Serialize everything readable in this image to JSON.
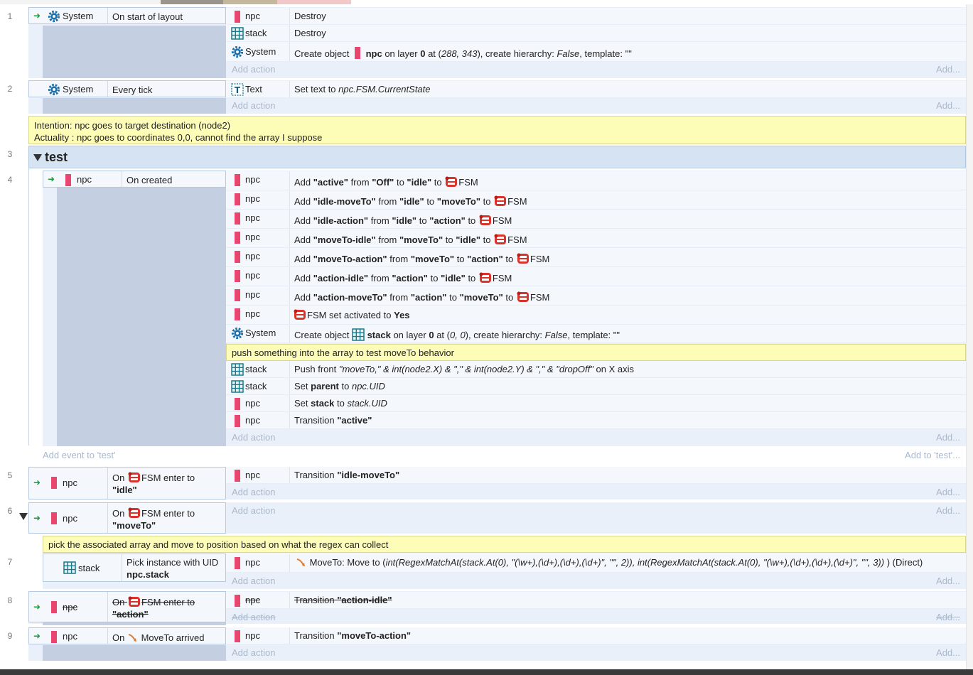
{
  "line_numbers": [
    "1",
    "2",
    "3",
    "4",
    "5",
    "6",
    "7",
    "8",
    "9"
  ],
  "add_action": "Add action",
  "add_action_more": "Add...",
  "events": {
    "e1": {
      "object": "System",
      "condition": "On start of layout",
      "actions": [
        {
          "object": "npc",
          "text": "Destroy"
        },
        {
          "object": "stack",
          "text": "Destroy"
        },
        {
          "object": "System",
          "pre": "Create object",
          "obj": "npc",
          "mid1": "on layer",
          "layer": "0",
          "mid2": "at (",
          "coords": "288, 343",
          "mid3": "), create hierarchy:",
          "hier": "False",
          "mid4": ", template: \"\""
        }
      ]
    },
    "e2": {
      "object": "System",
      "condition": "Every tick",
      "actions": [
        {
          "object": "Text",
          "pre": "Set text to",
          "expr": "npc.FSM.CurrentState"
        }
      ]
    },
    "comment1": {
      "line1": "Intention: npc goes to target destination (node2)",
      "line2": "Actuality : npc goes to coordinates 0,0, cannot find the array I suppose"
    },
    "group": {
      "name": "test",
      "add_event": "Add event to 'test'",
      "add_event_more": "Add to 'test'..."
    },
    "e4": {
      "object": "npc",
      "condition": "On created",
      "fsm_adds": [
        {
          "name": "\"active\"",
          "from": "\"Off\"",
          "to": "\"idle\""
        },
        {
          "name": "\"idle-moveTo\"",
          "from": "\"idle\"",
          "to": "\"moveTo\""
        },
        {
          "name": "\"idle-action\"",
          "from": "\"idle\"",
          "to": "\"action\""
        },
        {
          "name": "\"moveTo-idle\"",
          "from": "\"moveTo\"",
          "to": "\"idle\""
        },
        {
          "name": "\"moveTo-action\"",
          "from": "\"moveTo\"",
          "to": "\"action\""
        },
        {
          "name": "\"action-idle\"",
          "from": "\"action\"",
          "to": "\"idle\""
        },
        {
          "name": "\"action-moveTo\"",
          "from": "\"action\"",
          "to": "\"moveTo\""
        }
      ],
      "words": {
        "add": "Add",
        "from": "from",
        "to": "to",
        "fsm": "FSM"
      },
      "fsm_set": {
        "object": "npc",
        "text": "FSM set activated to",
        "value": "Yes"
      },
      "create": {
        "object": "System",
        "pre": "Create object",
        "obj": "stack",
        "mid1": "on layer",
        "layer": "0",
        "mid2": "at (",
        "coords": "0, 0",
        "mid3": "), create hierarchy:",
        "hier": "False",
        "mid4": ", template: \"\""
      },
      "comment": "push something into the array to test moveTo behavior",
      "push": {
        "object": "stack",
        "pre": "Push front",
        "expr": "\"moveTo,\" & int(node2.X) & \",\" & int(node2.Y) & \",\" & \"dropOff\"",
        "post": "on X axis"
      },
      "set_parent": {
        "object": "stack",
        "pre": "Set",
        "var": "parent",
        "to": "to",
        "expr": "npc.UID"
      },
      "set_stack": {
        "object": "npc",
        "pre": "Set",
        "var": "stack",
        "to": "to",
        "expr": "stack.UID"
      },
      "transition": {
        "object": "npc",
        "pre": "Transition",
        "name": "\"active\""
      }
    },
    "e5": {
      "object": "npc",
      "on": "On",
      "fsm": "FSM",
      "enter": "enter to",
      "state": "\"idle\"",
      "action": {
        "object": "npc",
        "pre": "Transition",
        "name": "\"idle-moveTo\""
      }
    },
    "e6": {
      "object": "npc",
      "on": "On",
      "fsm": "FSM",
      "enter": "enter to",
      "state": "\"moveTo\""
    },
    "comment2": "pick the associated array and move to position based on what the regex can collect",
    "e7": {
      "object": "stack",
      "cond_line1": "Pick instance with UID",
      "cond_line2": "npc.stack",
      "action": {
        "object": "npc",
        "pre": "MoveTo: Move to (",
        "expr": "int(RegexMatchAt(stack.At(0), \"(\\w+),(\\d+),(\\d+),(\\d+)\", \"\", 2)), int(RegexMatchAt(stack.At(0), \"(\\w+),(\\d+),(\\d+),(\\d+)\", \"\", 3))",
        "post": ") (Direct)"
      }
    },
    "e8": {
      "object": "npc",
      "on": "On",
      "fsm": "FSM",
      "enter": "enter to",
      "state": "\"action\"",
      "action": {
        "object": "npc",
        "pre": "Transition",
        "name": "\"action-idle\""
      }
    },
    "e9": {
      "object": "npc",
      "on": "On",
      "cond": "MoveTo arrived",
      "action": {
        "object": "npc",
        "pre": "Transition",
        "name": "\"moveTo-action\""
      }
    }
  },
  "colors": {
    "accent_pink": "#e8466e",
    "event_bg": "#eaf0f9",
    "comment_bg": "#fefdb8",
    "group_bg": "#d6e3f3"
  }
}
